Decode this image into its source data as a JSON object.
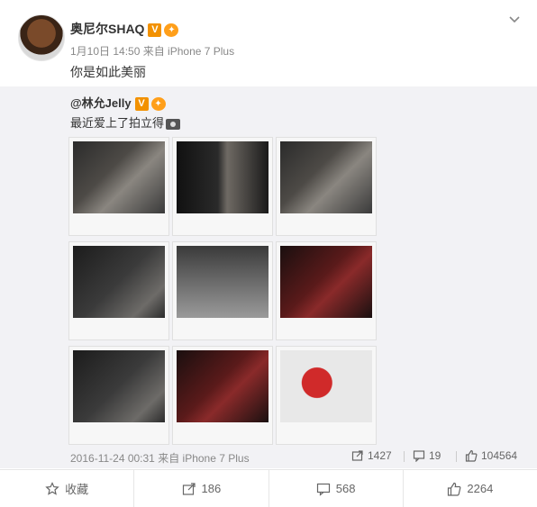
{
  "post": {
    "author": "奥尼尔SHAQ",
    "verified": "V",
    "meta": "1月10日 14:50 来自 iPhone 7 Plus",
    "text": "你是如此美丽"
  },
  "repost": {
    "author": "@林允Jelly",
    "verified": "V",
    "text": "最近爱上了拍立得",
    "meta": "2016-11-24 00:31 来自 iPhone 7 Plus",
    "forwards": "1427",
    "comments": "19",
    "likes": "104564",
    "photos": [
      {
        "theme": "dark-shelf"
      },
      {
        "theme": "dark-door"
      },
      {
        "theme": "dark-shelf"
      },
      {
        "theme": "dark-room"
      },
      {
        "theme": "shoes"
      },
      {
        "theme": "red-dark"
      },
      {
        "theme": "dark-room"
      },
      {
        "theme": "red-dark"
      },
      {
        "theme": "light-heart"
      }
    ]
  },
  "actions": {
    "favorite": "收藏",
    "forward": "186",
    "comment": "568",
    "like": "2264"
  },
  "colors": {
    "orange": "#f29100",
    "bg_repost": "#f2f2f5"
  }
}
